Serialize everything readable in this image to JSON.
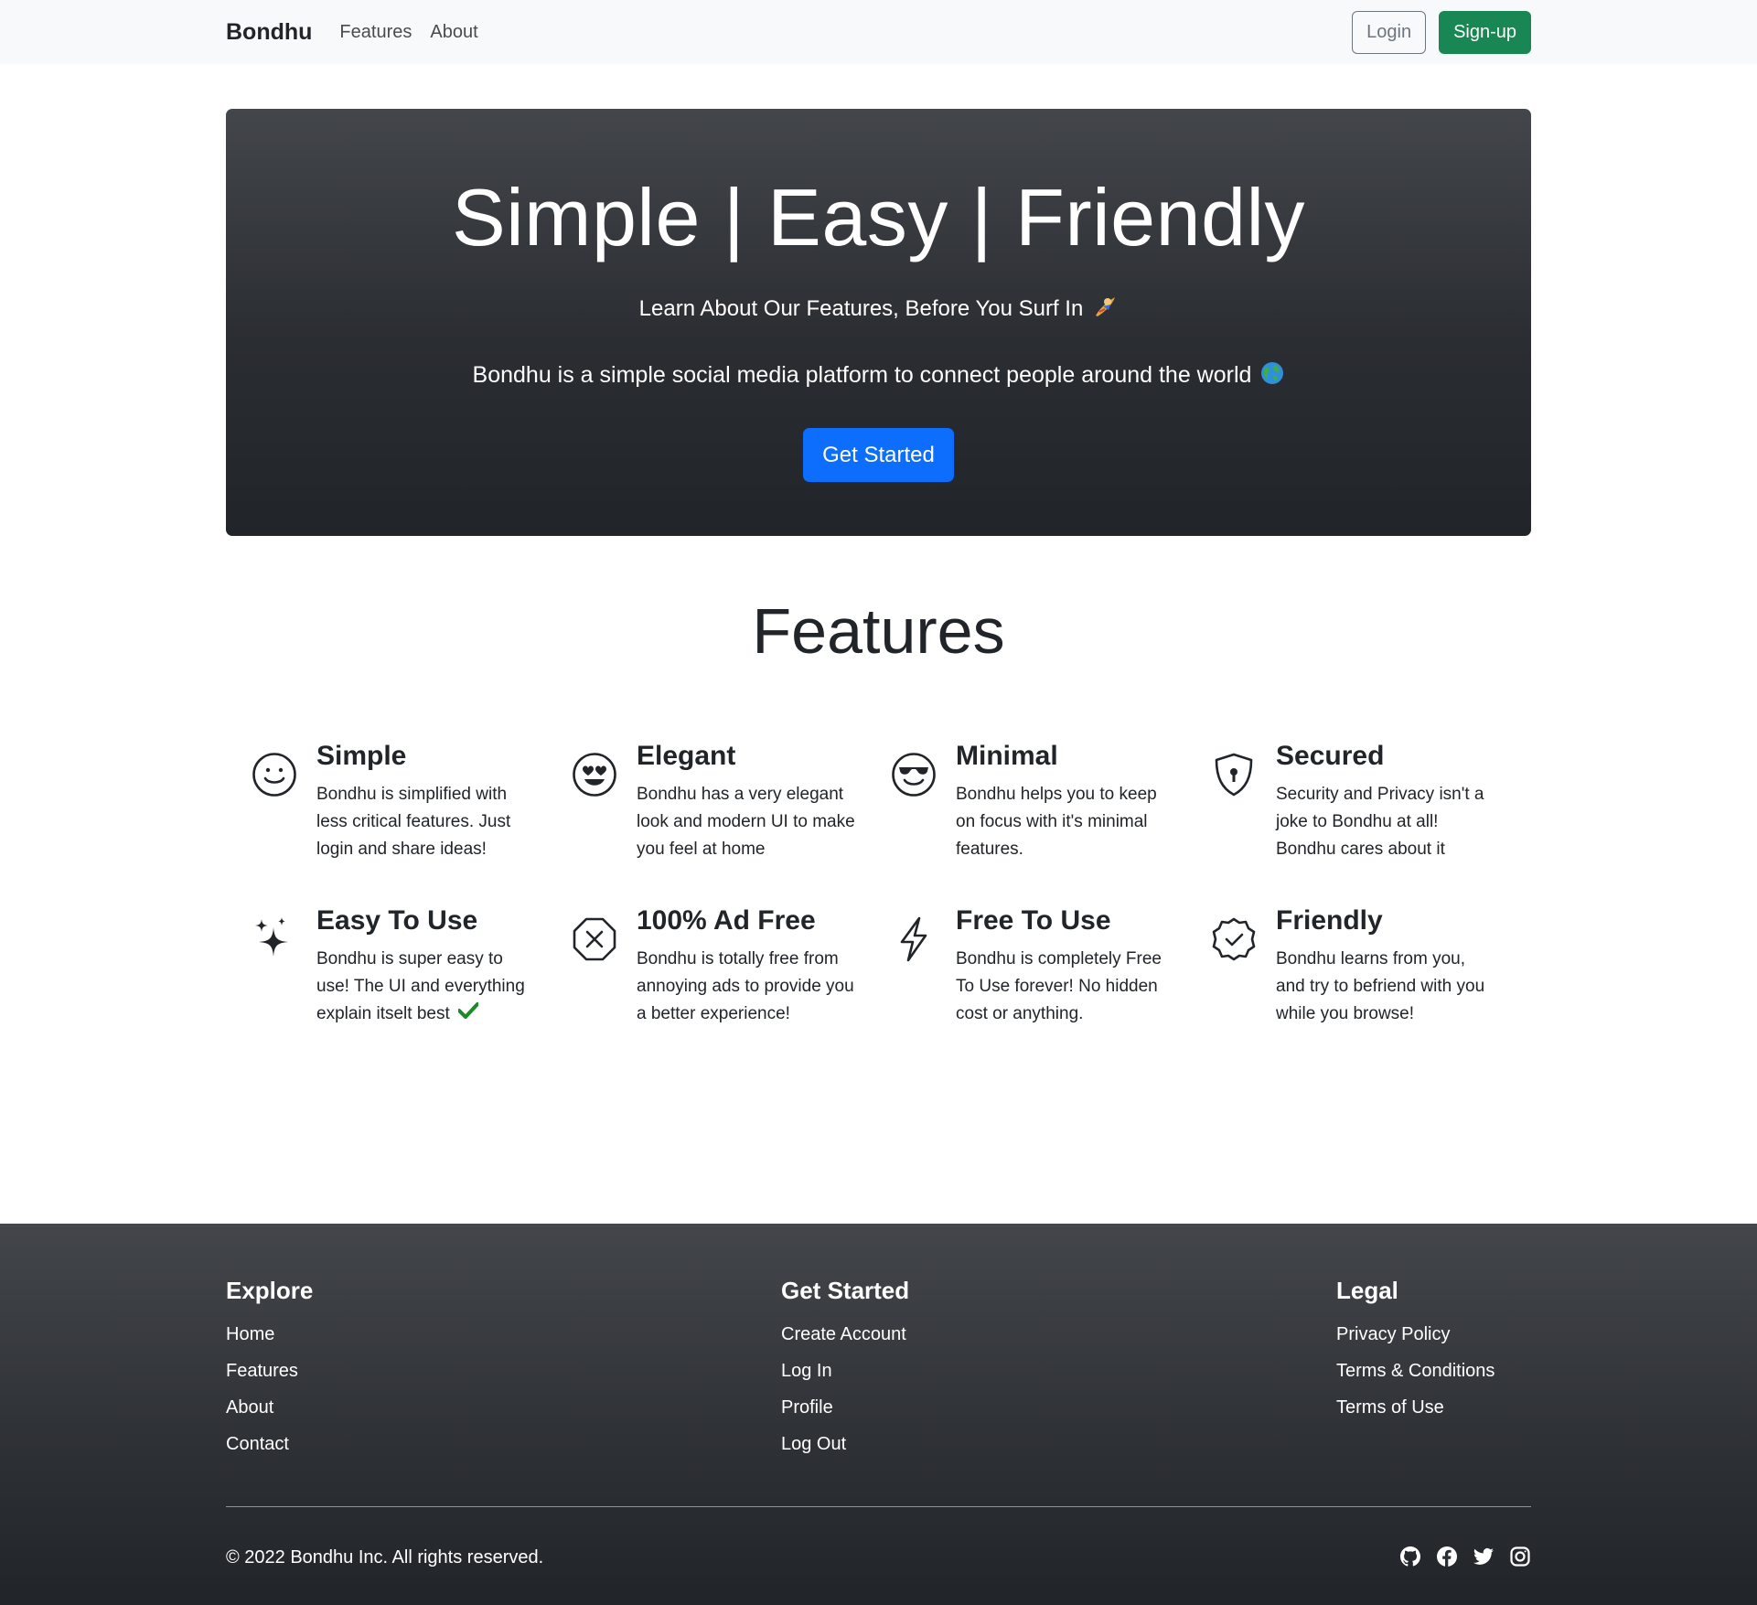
{
  "navbar": {
    "brand": "Bondhu",
    "links": [
      "Features",
      "About"
    ],
    "login_label": "Login",
    "signup_label": "Sign-up"
  },
  "hero": {
    "title": "Simple | Easy | Friendly",
    "subtitle": "Learn About Our Features, Before You Surf In",
    "description": "Bondhu is a simple social media platform to connect people around the world",
    "cta_label": "Get Started"
  },
  "features": {
    "heading": "Features",
    "items": [
      {
        "title": "Simple",
        "desc": "Bondhu is simplified with less critical features. Just login and share ideas!",
        "icon": "smile-icon"
      },
      {
        "title": "Elegant",
        "desc": "Bondhu has a very elegant look and modern UI to make you feel at home",
        "icon": "heart-eyes-icon"
      },
      {
        "title": "Minimal",
        "desc": "Bondhu helps you to keep on focus with it's minimal features.",
        "icon": "sunglasses-icon"
      },
      {
        "title": "Secured",
        "desc": "Security and Privacy isn't a joke to Bondhu at all! Bondhu cares about it",
        "icon": "shield-lock-icon"
      },
      {
        "title": "Easy To Use",
        "desc": "Bondhu is super easy to use! The UI and everything explain itselt best",
        "icon": "stars-icon"
      },
      {
        "title": "100% Ad Free",
        "desc": "Bondhu is totally free from annoying ads to provide you a better experience!",
        "icon": "octagon-x-icon"
      },
      {
        "title": "Free To Use",
        "desc": "Bondhu is completely Free To Use forever! No hidden cost or anything.",
        "icon": "lightning-icon"
      },
      {
        "title": "Friendly",
        "desc": "Bondhu learns from you, and try to befriend with you while you browse!",
        "icon": "patch-check-icon"
      }
    ]
  },
  "footer": {
    "explore": {
      "heading": "Explore",
      "links": [
        "Home",
        "Features",
        "About",
        "Contact"
      ]
    },
    "get_started": {
      "heading": "Get Started",
      "links": [
        "Create Account",
        "Log In",
        "Profile",
        "Log Out"
      ]
    },
    "legal": {
      "heading": "Legal",
      "links": [
        "Privacy Policy",
        "Terms & Conditions",
        "Terms of Use"
      ]
    },
    "copyright": "© 2022 Bondhu Inc. All rights reserved.",
    "socials": [
      "github-icon",
      "facebook-icon",
      "twitter-icon",
      "instagram-icon"
    ]
  },
  "colors": {
    "primary": "#0d6efd",
    "success": "#198754",
    "dark": "#212529",
    "light": "#f8f9fa"
  }
}
